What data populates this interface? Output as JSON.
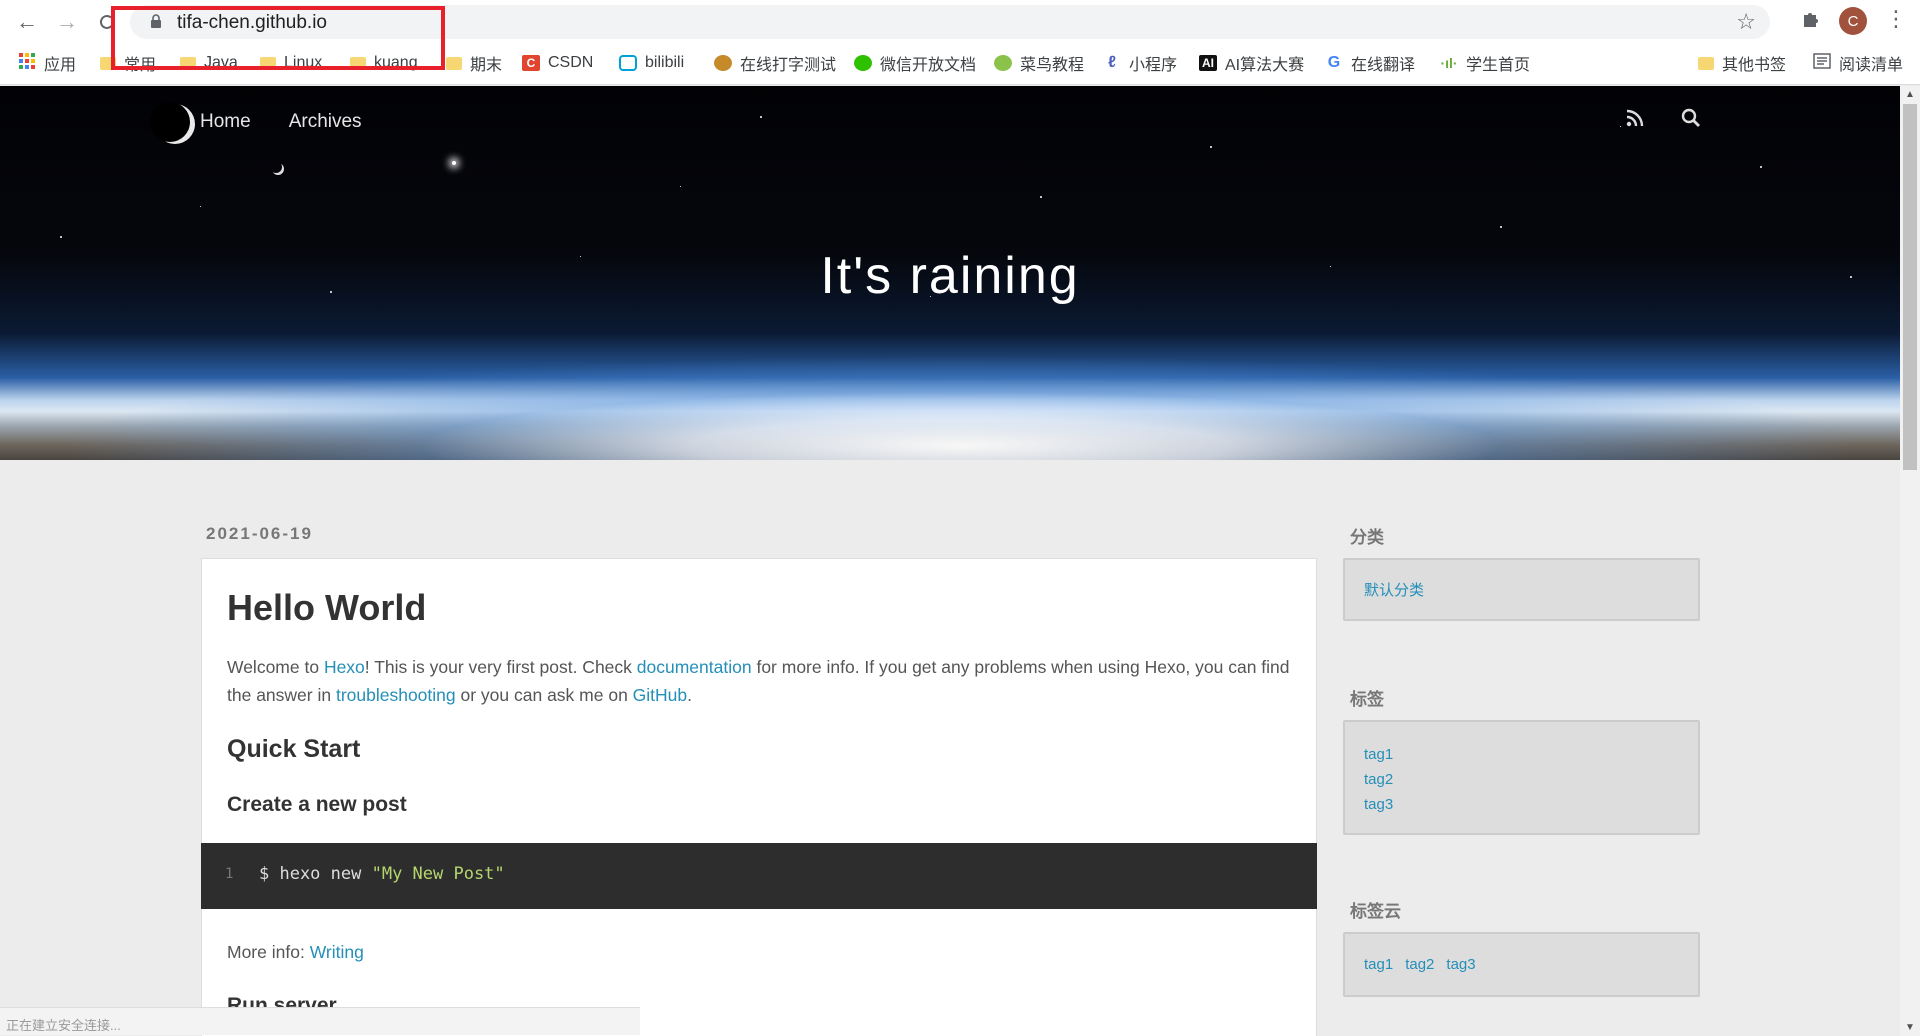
{
  "browser": {
    "url": "tifa-chen.github.io",
    "avatar_letter": "C",
    "bookmarks": [
      {
        "label": "应用",
        "icon": "apps-grid-icon"
      },
      {
        "label": "常用",
        "icon": "folder-icon"
      },
      {
        "label": "Java",
        "icon": "folder-icon"
      },
      {
        "label": "Linux",
        "icon": "folder-icon"
      },
      {
        "label": "kuang",
        "icon": "folder-icon"
      },
      {
        "label": "期末",
        "icon": "folder-icon"
      },
      {
        "label": "CSDN",
        "icon": "csdn-icon"
      },
      {
        "label": "bilibili",
        "icon": "bilibili-icon"
      },
      {
        "label": "在线打字测试",
        "icon": "typing-test-icon"
      },
      {
        "label": "微信开放文档",
        "icon": "wechat-icon"
      },
      {
        "label": "菜鸟教程",
        "icon": "runoob-icon"
      },
      {
        "label": "小程序",
        "icon": "miniprogram-icon"
      },
      {
        "label": "AI算法大赛",
        "icon": "ai-icon"
      },
      {
        "label": "在线翻译",
        "icon": "google-icon"
      },
      {
        "label": "学生首页",
        "icon": "student-home-icon"
      },
      {
        "label": "其他书签",
        "icon": "folder-icon"
      },
      {
        "label": "阅读清单",
        "icon": "reading-list-icon"
      }
    ],
    "status_text": "正在建立安全连接..."
  },
  "site": {
    "nav": [
      "Home",
      "Archives"
    ],
    "title": "It's raining"
  },
  "post": {
    "date": "2021-06-19",
    "title": "Hello World",
    "intro": {
      "t1": "Welcome to ",
      "l1": "Hexo",
      "t2": "! This is your very first post. Check ",
      "l2": "documentation",
      "t3": " for more info. If you get any problems when using Hexo, you can find the answer in ",
      "l3": "troubleshooting",
      "t4": " or you can ask me on ",
      "l4": "GitHub",
      "t5": "."
    },
    "h_quick_start": "Quick Start",
    "h_create_post": "Create a new post",
    "code": {
      "line_no": "1",
      "cmd": "$ hexo new ",
      "arg": "\"My New Post\""
    },
    "more_info_label": "More info: ",
    "more_info_link": "Writing",
    "h_run_server": "Run server"
  },
  "sidebar": {
    "categories_title": "分类",
    "categories": [
      "默认分类"
    ],
    "tags_title": "标签",
    "tags": [
      "tag1",
      "tag2",
      "tag3"
    ],
    "tagcloud_title": "标签云",
    "tagcloud": [
      "tag1",
      "tag2",
      "tag3"
    ]
  }
}
